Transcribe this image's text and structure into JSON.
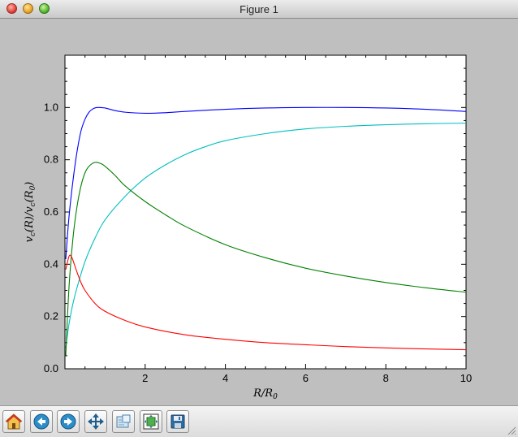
{
  "window": {
    "title": "Figure 1"
  },
  "toolbar": {
    "buttons": [
      {
        "name": "home",
        "icon": "home-icon"
      },
      {
        "name": "back",
        "icon": "back-arrow-icon"
      },
      {
        "name": "forward",
        "icon": "forward-arrow-icon"
      },
      {
        "name": "pan",
        "icon": "pan-arrows-icon"
      },
      {
        "name": "zoom",
        "icon": "zoom-rect-icon"
      },
      {
        "name": "subplots",
        "icon": "subplots-icon"
      },
      {
        "name": "save",
        "icon": "save-disk-icon"
      }
    ]
  },
  "colors": {
    "blue": "#0000ff",
    "cyan": "#00bfbf",
    "green": "#008000",
    "red": "#ff0000"
  },
  "chart_data": {
    "type": "line",
    "title": "",
    "xlabel": "R/R_0",
    "ylabel": "v_c(R)/v_c(R_0)",
    "xlim": [
      0.0,
      10.0
    ],
    "ylim": [
      0.0,
      1.2
    ],
    "xticks": [
      2,
      4,
      6,
      8,
      10
    ],
    "yticks": [
      0.0,
      0.2,
      0.4,
      0.6,
      0.8,
      1.0
    ],
    "ytick_labels": [
      "0.0",
      "0.2",
      "0.4",
      "0.6",
      "0.8",
      "1.0"
    ],
    "grid": false,
    "series": [
      {
        "color": "#0000ff",
        "points": [
          [
            0.02,
            0.42
          ],
          [
            0.1,
            0.58
          ],
          [
            0.2,
            0.72
          ],
          [
            0.3,
            0.83
          ],
          [
            0.4,
            0.91
          ],
          [
            0.5,
            0.955
          ],
          [
            0.6,
            0.982
          ],
          [
            0.7,
            0.995
          ],
          [
            0.8,
            1.0
          ],
          [
            1.0,
            0.998
          ],
          [
            1.2,
            0.99
          ],
          [
            1.5,
            0.982
          ],
          [
            2.0,
            0.978
          ],
          [
            2.5,
            0.98
          ],
          [
            3.0,
            0.985
          ],
          [
            4.0,
            0.993
          ],
          [
            5.0,
            0.998
          ],
          [
            6.0,
            1.0
          ],
          [
            7.0,
            1.0
          ],
          [
            8.0,
            0.998
          ],
          [
            9.0,
            0.993
          ],
          [
            10.0,
            0.985
          ]
        ]
      },
      {
        "color": "#00bfbf",
        "points": [
          [
            0.02,
            0.08
          ],
          [
            0.1,
            0.17
          ],
          [
            0.2,
            0.25
          ],
          [
            0.3,
            0.31
          ],
          [
            0.5,
            0.41
          ],
          [
            0.75,
            0.5
          ],
          [
            1.0,
            0.57
          ],
          [
            1.5,
            0.66
          ],
          [
            2.0,
            0.73
          ],
          [
            2.5,
            0.78
          ],
          [
            3.0,
            0.82
          ],
          [
            3.5,
            0.85
          ],
          [
            4.0,
            0.873
          ],
          [
            5.0,
            0.9
          ],
          [
            6.0,
            0.918
          ],
          [
            7.0,
            0.928
          ],
          [
            8.0,
            0.934
          ],
          [
            9.0,
            0.938
          ],
          [
            10.0,
            0.94
          ]
        ]
      },
      {
        "color": "#008000",
        "points": [
          [
            0.02,
            0.05
          ],
          [
            0.1,
            0.31
          ],
          [
            0.2,
            0.5
          ],
          [
            0.3,
            0.62
          ],
          [
            0.4,
            0.7
          ],
          [
            0.5,
            0.75
          ],
          [
            0.6,
            0.775
          ],
          [
            0.75,
            0.79
          ],
          [
            0.9,
            0.785
          ],
          [
            1.0,
            0.775
          ],
          [
            1.25,
            0.74
          ],
          [
            1.5,
            0.7
          ],
          [
            2.0,
            0.64
          ],
          [
            2.5,
            0.59
          ],
          [
            3.0,
            0.545
          ],
          [
            4.0,
            0.475
          ],
          [
            5.0,
            0.425
          ],
          [
            6.0,
            0.385
          ],
          [
            7.0,
            0.355
          ],
          [
            8.0,
            0.33
          ],
          [
            9.0,
            0.31
          ],
          [
            10.0,
            0.293
          ]
        ]
      },
      {
        "color": "#ff0000",
        "points": [
          [
            0.02,
            0.38
          ],
          [
            0.1,
            0.43
          ],
          [
            0.15,
            0.432
          ],
          [
            0.2,
            0.415
          ],
          [
            0.3,
            0.37
          ],
          [
            0.4,
            0.33
          ],
          [
            0.5,
            0.3
          ],
          [
            0.75,
            0.25
          ],
          [
            1.0,
            0.22
          ],
          [
            1.5,
            0.185
          ],
          [
            2.0,
            0.16
          ],
          [
            3.0,
            0.13
          ],
          [
            4.0,
            0.113
          ],
          [
            5.0,
            0.1
          ],
          [
            6.0,
            0.092
          ],
          [
            7.0,
            0.085
          ],
          [
            8.0,
            0.08
          ],
          [
            9.0,
            0.076
          ],
          [
            10.0,
            0.073
          ]
        ]
      }
    ]
  }
}
